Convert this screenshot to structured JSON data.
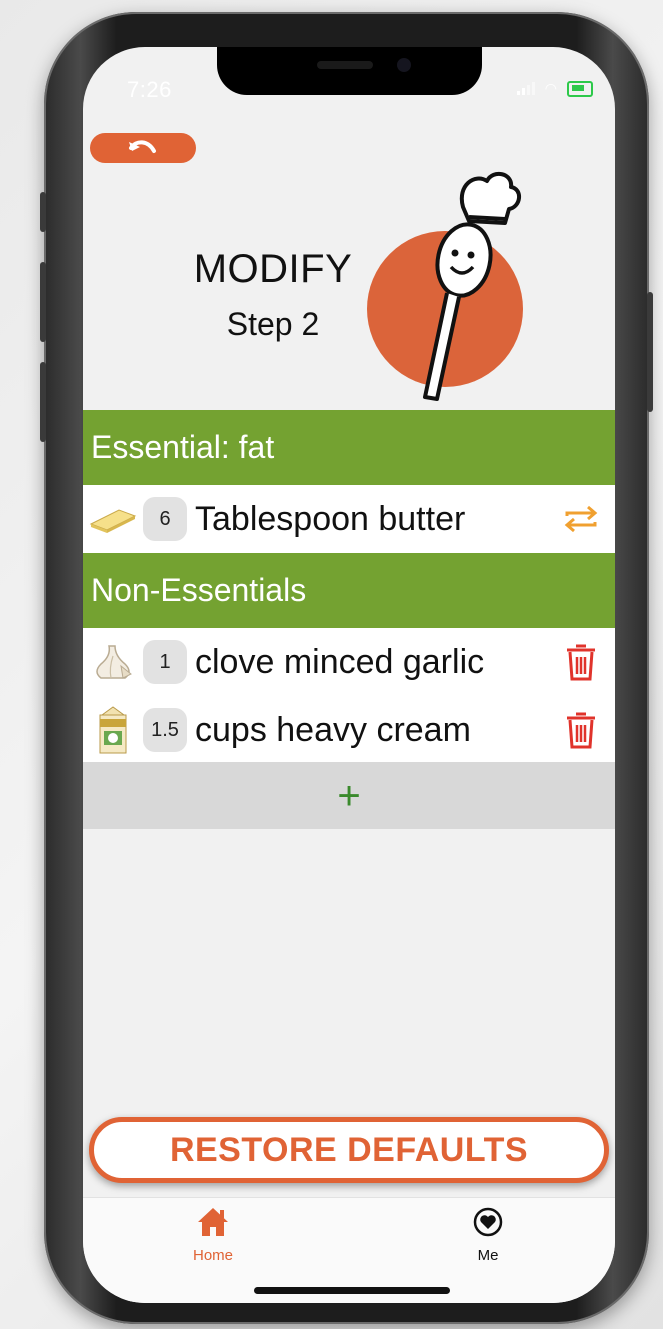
{
  "status_bar": {
    "time": "7:26"
  },
  "header": {
    "title": "MODIFY",
    "subtitle": "Step 2",
    "back_icon": "undo-arrow-icon",
    "logo_icon": "chef-spoon-logo"
  },
  "sections": {
    "essential": {
      "heading": "Essential: fat",
      "items": [
        {
          "qty": "6",
          "name": "Tablespoon butter",
          "icon": "butter-icon",
          "action_icon": "swap-icon"
        }
      ]
    },
    "non_essential": {
      "heading": "Non-Essentials",
      "items": [
        {
          "qty": "1",
          "name": "clove minced garlic",
          "icon": "garlic-icon",
          "action_icon": "trash-icon"
        },
        {
          "qty": "1.5",
          "name": "cups heavy cream",
          "icon": "cream-carton-icon",
          "action_icon": "trash-icon"
        }
      ]
    }
  },
  "add_button": {
    "label": "+"
  },
  "restore_button": {
    "label": "RESTORE DEFAULTS"
  },
  "tabbar": {
    "tabs": [
      {
        "label": "Home",
        "icon": "home-icon",
        "active": true
      },
      {
        "label": "Me",
        "icon": "heart-circle-icon",
        "active": false
      }
    ]
  },
  "colors": {
    "accent": "#e06335",
    "section_green": "#74a231",
    "add_green": "#3a8a2c",
    "trash_red": "#e0332b",
    "swap_orange": "#f0a030"
  }
}
